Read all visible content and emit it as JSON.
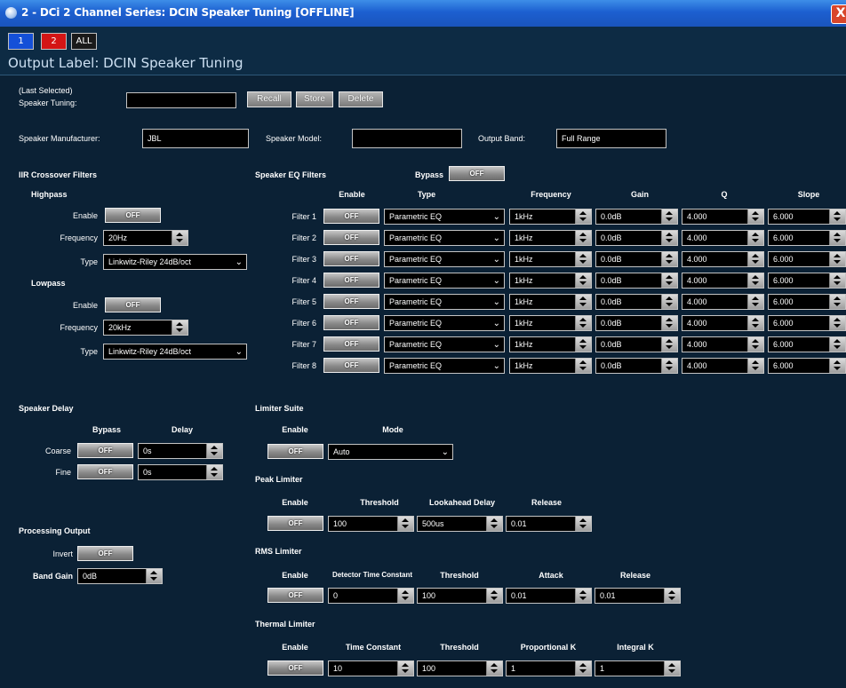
{
  "window": {
    "title": "2 - DCi 2 Channel Series: DCIN Speaker Tuning [OFFLINE]",
    "close": "X"
  },
  "channel_tabs": [
    "1",
    "2",
    "ALL"
  ],
  "output_label": "Output Label: DCIN Speaker Tuning",
  "tuning": {
    "label_line1": "(Last Selected)",
    "label_line2": "Speaker Tuning:",
    "value": "",
    "recall": "Recall",
    "store": "Store",
    "delete": "Delete"
  },
  "speaker": {
    "manufacturer_label": "Speaker Manufacturer:",
    "manufacturer": "JBL",
    "model_label": "Speaker Model:",
    "model": "",
    "band_label": "Output Band:",
    "band": "Full Range"
  },
  "iir": {
    "title": "IIR Crossover Filters",
    "highpass": {
      "title": "Highpass",
      "enable_label": "Enable",
      "enable": "OFF",
      "freq_label": "Frequency",
      "freq": "20Hz",
      "type_label": "Type",
      "type": "Linkwitz-Riley 24dB/oct"
    },
    "lowpass": {
      "title": "Lowpass",
      "enable_label": "Enable",
      "enable": "OFF",
      "freq_label": "Frequency",
      "freq": "20kHz",
      "type_label": "Type",
      "type": "Linkwitz-Riley 24dB/oct"
    }
  },
  "eq": {
    "title": "Speaker EQ Filters",
    "bypass_label": "Bypass",
    "bypass": "OFF",
    "headers": {
      "enable": "Enable",
      "type": "Type",
      "frequency": "Frequency",
      "gain": "Gain",
      "q": "Q",
      "slope": "Slope"
    },
    "filters": [
      {
        "label": "Filter 1",
        "enable": "OFF",
        "type": "Parametric EQ",
        "freq": "1kHz",
        "gain": "0.0dB",
        "q": "4.000",
        "slope": "6.000"
      },
      {
        "label": "Filter 2",
        "enable": "OFF",
        "type": "Parametric EQ",
        "freq": "1kHz",
        "gain": "0.0dB",
        "q": "4.000",
        "slope": "6.000"
      },
      {
        "label": "Filter 3",
        "enable": "OFF",
        "type": "Parametric EQ",
        "freq": "1kHz",
        "gain": "0.0dB",
        "q": "4.000",
        "slope": "6.000"
      },
      {
        "label": "Filter 4",
        "enable": "OFF",
        "type": "Parametric EQ",
        "freq": "1kHz",
        "gain": "0.0dB",
        "q": "4.000",
        "slope": "6.000"
      },
      {
        "label": "Filter 5",
        "enable": "OFF",
        "type": "Parametric EQ",
        "freq": "1kHz",
        "gain": "0.0dB",
        "q": "4.000",
        "slope": "6.000"
      },
      {
        "label": "Filter 6",
        "enable": "OFF",
        "type": "Parametric EQ",
        "freq": "1kHz",
        "gain": "0.0dB",
        "q": "4.000",
        "slope": "6.000"
      },
      {
        "label": "Filter 7",
        "enable": "OFF",
        "type": "Parametric EQ",
        "freq": "1kHz",
        "gain": "0.0dB",
        "q": "4.000",
        "slope": "6.000"
      },
      {
        "label": "Filter 8",
        "enable": "OFF",
        "type": "Parametric EQ",
        "freq": "1kHz",
        "gain": "0.0dB",
        "q": "4.000",
        "slope": "6.000"
      }
    ]
  },
  "delay": {
    "title": "Speaker Delay",
    "bypass_header": "Bypass",
    "delay_header": "Delay",
    "coarse_label": "Coarse",
    "coarse_bypass": "OFF",
    "coarse_value": "0s",
    "fine_label": "Fine",
    "fine_bypass": "OFF",
    "fine_value": "0s"
  },
  "processing": {
    "title": "Processing Output",
    "invert_label": "Invert",
    "invert": "OFF",
    "gain_label": "Band Gain",
    "gain": "0dB"
  },
  "limiter": {
    "title": "Limiter Suite",
    "enable_header": "Enable",
    "mode_header": "Mode",
    "enable": "OFF",
    "mode": "Auto",
    "peak": {
      "title": "Peak Limiter",
      "enable_header": "Enable",
      "threshold_header": "Threshold",
      "lookahead_header": "Lookahead Delay",
      "release_header": "Release",
      "enable": "OFF",
      "threshold": "100",
      "lookahead": "500us",
      "release": "0.01"
    },
    "rms": {
      "title": "RMS Limiter",
      "enable_header": "Enable",
      "detector_header": "Detector Time Constant",
      "threshold_header": "Threshold",
      "attack_header": "Attack",
      "release_header": "Release",
      "enable": "OFF",
      "detector": "0",
      "threshold": "100",
      "attack": "0.01",
      "release": "0.01"
    },
    "thermal": {
      "title": "Thermal Limiter",
      "enable_header": "Enable",
      "time_header": "Time Constant",
      "threshold_header": "Threshold",
      "prop_header": "Proportional K",
      "integral_header": "Integral K",
      "enable": "OFF",
      "time": "10",
      "threshold": "100",
      "prop": "1",
      "integral": "1"
    }
  }
}
